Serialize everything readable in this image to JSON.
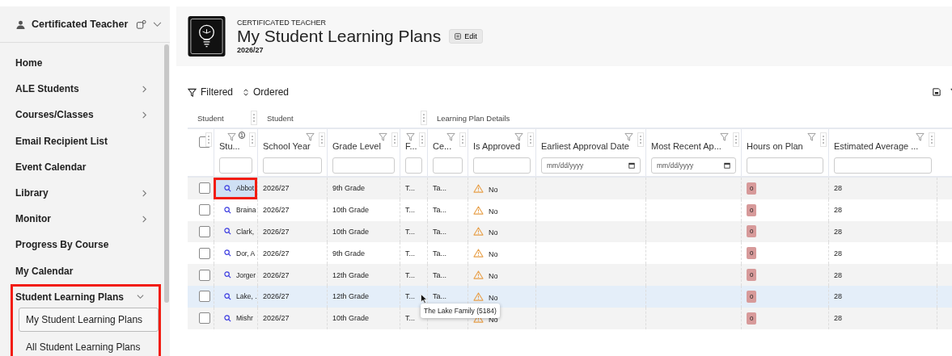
{
  "sidebar": {
    "user": "Certificated Teacher",
    "items": [
      {
        "label": "Home",
        "has_submenu": false
      },
      {
        "label": "ALE Students",
        "has_submenu": true
      },
      {
        "label": "Courses/Classes",
        "has_submenu": true
      },
      {
        "label": "Email Recipient List",
        "has_submenu": false
      },
      {
        "label": "Event Calendar",
        "has_submenu": false
      },
      {
        "label": "Library",
        "has_submenu": true
      },
      {
        "label": "Monitor",
        "has_submenu": true
      },
      {
        "label": "Progress By Course",
        "has_submenu": false
      },
      {
        "label": "My Calendar",
        "has_submenu": false
      },
      {
        "label": "Student Learning Plans",
        "has_submenu": true,
        "expanded": true,
        "highlighted": true,
        "children": [
          {
            "label": "My Student Learning Plans",
            "selected": true
          },
          {
            "label": "All Student Learning Plans",
            "selected": false
          }
        ]
      }
    ]
  },
  "header": {
    "kicker": "CERTIFICATED TEACHER",
    "title": "My Student Learning Plans",
    "edit": "Edit",
    "subtitle": "2026/27"
  },
  "toolbar": {
    "filtered": "Filtered",
    "ordered": "Ordered"
  },
  "table": {
    "groups": [
      "Student",
      "Student",
      "Learning Plan Details"
    ],
    "columns": [
      {
        "kind": "select",
        "checked": false
      },
      {
        "label": "Stu...",
        "kind": "text",
        "sort": "1"
      },
      {
        "label": "School Year",
        "kind": "text"
      },
      {
        "label": "Grade Level",
        "kind": "text"
      },
      {
        "label": "F...",
        "kind": "text"
      },
      {
        "label": "Ce...",
        "kind": "text"
      },
      {
        "label": "Is Approved",
        "kind": "text"
      },
      {
        "label": "Earliest Approval Date",
        "kind": "date",
        "placeholder": "mm/dd/yyyy"
      },
      {
        "label": "Most Recent Ap...",
        "kind": "date",
        "placeholder": "mm/dd/yyyy"
      },
      {
        "label": "Hours on Plan",
        "kind": "text"
      },
      {
        "label": "Estimated Average ...",
        "kind": "text"
      }
    ],
    "rows": [
      {
        "checked": false,
        "hovered": false,
        "student": "Abbot",
        "student_highlighted": true,
        "school_year": "2026/27",
        "grade": "9th Grade",
        "col_f": "T...",
        "col_ce": "Ta...",
        "approved": "No",
        "hours": "0",
        "estimated": "28"
      },
      {
        "checked": false,
        "hovered": false,
        "student": "Braina",
        "student_highlighted": false,
        "school_year": "2026/27",
        "grade": "10th Grade",
        "col_f": "T...",
        "col_ce": "Ta...",
        "approved": "No",
        "hours": "0",
        "estimated": "28"
      },
      {
        "checked": false,
        "hovered": false,
        "student": "Clark,",
        "student_highlighted": false,
        "school_year": "2026/27",
        "grade": "10th Grade",
        "col_f": "T...",
        "col_ce": "Ta...",
        "approved": "No",
        "hours": "0",
        "estimated": "28"
      },
      {
        "checked": false,
        "hovered": false,
        "student": "Dor, A",
        "student_highlighted": false,
        "school_year": "2026/27",
        "grade": "9th Grade",
        "col_f": "T...",
        "col_ce": "Ta...",
        "approved": "No",
        "hours": "0",
        "estimated": "28"
      },
      {
        "checked": false,
        "hovered": false,
        "student": "Jorger",
        "student_highlighted": false,
        "school_year": "2026/27",
        "grade": "12th Grade",
        "col_f": "T...",
        "col_ce": "Ta...",
        "approved": "No",
        "hours": "0",
        "estimated": "28"
      },
      {
        "checked": false,
        "hovered": true,
        "student": "Lake, .",
        "student_highlighted": false,
        "school_year": "2026/27",
        "grade": "12th Grade",
        "col_f": "T...",
        "col_ce": "Ta...",
        "approved": "No",
        "hours": "0",
        "estimated": "28",
        "tooltip": "The Lake Family (5184)"
      },
      {
        "checked": false,
        "hovered": false,
        "student": "Mishr",
        "student_highlighted": false,
        "school_year": "2026/27",
        "grade": "10th Grade",
        "col_f": "T...",
        "approved": "No",
        "hours": "0",
        "estimated": "28"
      }
    ]
  }
}
